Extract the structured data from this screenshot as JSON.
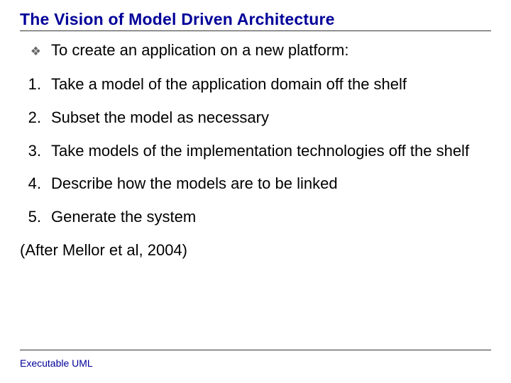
{
  "slide": {
    "title": "The Vision of Model Driven Architecture",
    "intro_bullet": "To create an application on a new platform:",
    "steps": {
      "s1": {
        "num": "1.",
        "text": "Take a model of the application domain off the shelf"
      },
      "s2": {
        "num": "2.",
        "text": "Subset the model as necessary"
      },
      "s3": {
        "num": "3.",
        "text": "Take models of the implementation technologies off the shelf"
      },
      "s4": {
        "num": "4.",
        "text": "Describe how the models are to be linked"
      },
      "s5": {
        "num": "5.",
        "text": "Generate the system"
      }
    },
    "attribution": "(After Mellor et al, 2004)",
    "footer": "Executable UML"
  }
}
